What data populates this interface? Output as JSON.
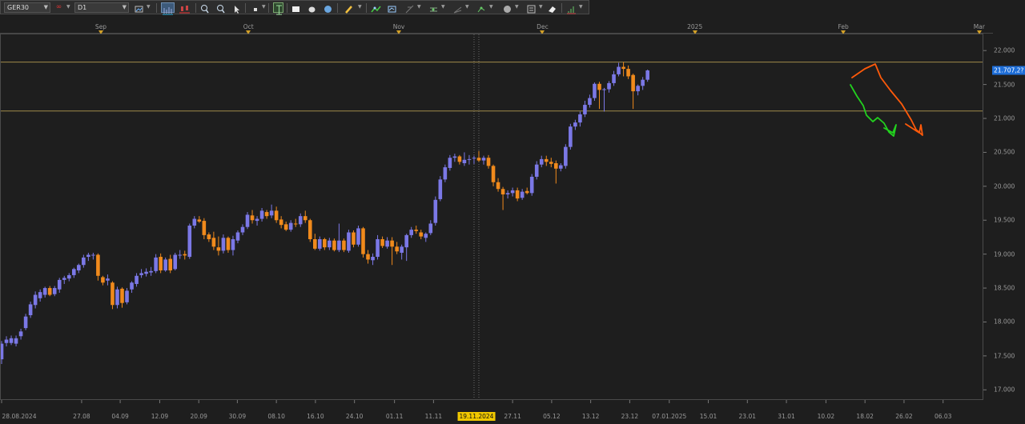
{
  "toolbar": {
    "symbol": "GER30",
    "timeframe": "D1",
    "link_glyph": "∞"
  },
  "top_axis": [
    {
      "label": "Sep",
      "day": 20.6
    },
    {
      "label": "Oct",
      "day": 51.2
    },
    {
      "label": "Nov",
      "day": 82.4
    },
    {
      "label": "Dec",
      "day": 112.2
    },
    {
      "label": "2025",
      "day": 143.8
    },
    {
      "label": "Feb",
      "day": 174.6
    },
    {
      "label": "Mar",
      "day": 202.8
    }
  ],
  "bottom_axis": [
    {
      "label": "28.08.2024",
      "day": 0
    },
    {
      "label": "27.08",
      "day": 16.6
    },
    {
      "label": "04.09",
      "day": 24.6
    },
    {
      "label": "12.09",
      "day": 32.8
    },
    {
      "label": "20.09",
      "day": 40.9
    },
    {
      "label": "30.09",
      "day": 48.9
    },
    {
      "label": "08.10",
      "day": 57.0
    },
    {
      "label": "16.10",
      "day": 65.1
    },
    {
      "label": "24.10",
      "day": 73.2
    },
    {
      "label": "01.11",
      "day": 81.5
    },
    {
      "label": "11.11",
      "day": 89.6
    },
    {
      "label": "27.11",
      "day": 106.0
    },
    {
      "label": "05.12",
      "day": 114.1
    },
    {
      "label": "13.12",
      "day": 122.2
    },
    {
      "label": "23.12",
      "day": 130.3
    },
    {
      "label": "07.01.2025",
      "day": 138.5
    },
    {
      "label": "15.01",
      "day": 146.6
    },
    {
      "label": "23.01",
      "day": 154.7
    },
    {
      "label": "31.01",
      "day": 162.8
    },
    {
      "label": "10.02",
      "day": 171.0
    },
    {
      "label": "18.02",
      "day": 179.1
    },
    {
      "label": "26.02",
      "day": 187.2
    },
    {
      "label": "06.03",
      "day": 195.3
    }
  ],
  "price_axis": [
    17000,
    17500,
    18000,
    18500,
    19000,
    19500,
    20000,
    20500,
    21000,
    21500,
    22000
  ],
  "price_axis_labels": [
    "17.000",
    "17.500",
    "18.000",
    "18.500",
    "19.000",
    "19.500",
    "20.000",
    "20.500",
    "21.000",
    "21.500",
    "22.000"
  ],
  "current_price": {
    "label": "21.707,2?",
    "value": 21707
  },
  "cursor": {
    "date_label": "19.11.2024",
    "day": 98.5
  },
  "hlines": [
    21830,
    21110
  ],
  "colors": {
    "bull": "#7b78e6",
    "bear": "#f08a1c",
    "hline": "#a08a4a",
    "arrow_orange": "#ff5a0a",
    "arrow_green": "#22d11e",
    "cursor_label": "#f0c800",
    "price_label": "#1e6ed8"
  },
  "chart_data": {
    "type": "candlestick",
    "ylim": [
      16850,
      22250
    ],
    "xlim_days": [
      0,
      200.5
    ],
    "candles": [
      {
        "day": 0,
        "o": 17450,
        "h": 17720,
        "l": 17380,
        "c": 17680
      },
      {
        "day": 1,
        "o": 17690,
        "h": 17790,
        "l": 17640,
        "c": 17740
      },
      {
        "day": 2,
        "o": 17690,
        "h": 17800,
        "l": 17660,
        "c": 17760
      },
      {
        "day": 3,
        "o": 17680,
        "h": 17800,
        "l": 17640,
        "c": 17760
      },
      {
        "day": 4,
        "o": 17790,
        "h": 17900,
        "l": 17740,
        "c": 17860
      },
      {
        "day": 5,
        "o": 17910,
        "h": 18120,
        "l": 17880,
        "c": 18080
      },
      {
        "day": 6,
        "o": 18100,
        "h": 18300,
        "l": 18060,
        "c": 18260
      },
      {
        "day": 7,
        "o": 18250,
        "h": 18450,
        "l": 18200,
        "c": 18400
      },
      {
        "day": 8,
        "o": 18350,
        "h": 18480,
        "l": 18300,
        "c": 18440
      },
      {
        "day": 9,
        "o": 18400,
        "h": 18520,
        "l": 18360,
        "c": 18500
      },
      {
        "day": 10,
        "o": 18500,
        "h": 18530,
        "l": 18380,
        "c": 18400
      },
      {
        "day": 11,
        "o": 18410,
        "h": 18530,
        "l": 18380,
        "c": 18500
      },
      {
        "day": 12,
        "o": 18480,
        "h": 18650,
        "l": 18430,
        "c": 18620
      },
      {
        "day": 13,
        "o": 18620,
        "h": 18680,
        "l": 18560,
        "c": 18650
      },
      {
        "day": 14,
        "o": 18640,
        "h": 18720,
        "l": 18600,
        "c": 18690
      },
      {
        "day": 15,
        "o": 18690,
        "h": 18800,
        "l": 18650,
        "c": 18780
      },
      {
        "day": 16,
        "o": 18760,
        "h": 18860,
        "l": 18720,
        "c": 18840
      },
      {
        "day": 17,
        "o": 18840,
        "h": 18990,
        "l": 18800,
        "c": 18950
      },
      {
        "day": 18,
        "o": 18960,
        "h": 19020,
        "l": 18900,
        "c": 18990
      },
      {
        "day": 19,
        "o": 18980,
        "h": 19020,
        "l": 18920,
        "c": 18990
      },
      {
        "day": 20,
        "o": 18990,
        "h": 19010,
        "l": 18610,
        "c": 18680
      },
      {
        "day": 21,
        "o": 18660,
        "h": 18680,
        "l": 18540,
        "c": 18580
      },
      {
        "day": 22,
        "o": 18610,
        "h": 18700,
        "l": 18540,
        "c": 18640
      },
      {
        "day": 23,
        "o": 18580,
        "h": 18600,
        "l": 18190,
        "c": 18250
      },
      {
        "day": 24,
        "o": 18250,
        "h": 18520,
        "l": 18200,
        "c": 18480
      },
      {
        "day": 25,
        "o": 18490,
        "h": 18510,
        "l": 18210,
        "c": 18280
      },
      {
        "day": 26,
        "o": 18290,
        "h": 18500,
        "l": 18260,
        "c": 18460
      },
      {
        "day": 27,
        "o": 18480,
        "h": 18600,
        "l": 18430,
        "c": 18580
      },
      {
        "day": 28,
        "o": 18560,
        "h": 18720,
        "l": 18520,
        "c": 18680
      },
      {
        "day": 29,
        "o": 18690,
        "h": 18780,
        "l": 18650,
        "c": 18720
      },
      {
        "day": 30,
        "o": 18710,
        "h": 18790,
        "l": 18670,
        "c": 18740
      },
      {
        "day": 31,
        "o": 18730,
        "h": 18810,
        "l": 18680,
        "c": 18750
      },
      {
        "day": 32,
        "o": 18750,
        "h": 19000,
        "l": 18720,
        "c": 18950
      },
      {
        "day": 33,
        "o": 18960,
        "h": 19010,
        "l": 18720,
        "c": 18760
      },
      {
        "day": 34,
        "o": 18760,
        "h": 18950,
        "l": 18740,
        "c": 18920
      },
      {
        "day": 35,
        "o": 18930,
        "h": 18990,
        "l": 18720,
        "c": 18760
      },
      {
        "day": 36,
        "o": 18780,
        "h": 19020,
        "l": 18760,
        "c": 18990
      },
      {
        "day": 37,
        "o": 18980,
        "h": 19060,
        "l": 18930,
        "c": 18990
      },
      {
        "day": 38,
        "o": 19000,
        "h": 19050,
        "l": 18920,
        "c": 18980
      },
      {
        "day": 39,
        "o": 18960,
        "h": 19450,
        "l": 18930,
        "c": 19420
      },
      {
        "day": 40,
        "o": 19420,
        "h": 19560,
        "l": 19380,
        "c": 19520
      },
      {
        "day": 41,
        "o": 19510,
        "h": 19560,
        "l": 19460,
        "c": 19480
      },
      {
        "day": 42,
        "o": 19490,
        "h": 19530,
        "l": 19220,
        "c": 19280
      },
      {
        "day": 43,
        "o": 19290,
        "h": 19320,
        "l": 19180,
        "c": 19220
      },
      {
        "day": 44,
        "o": 19240,
        "h": 19330,
        "l": 19060,
        "c": 19110
      },
      {
        "day": 45,
        "o": 19100,
        "h": 19260,
        "l": 18980,
        "c": 19050
      },
      {
        "day": 46,
        "o": 19050,
        "h": 19290,
        "l": 19010,
        "c": 19240
      },
      {
        "day": 47,
        "o": 19240,
        "h": 19260,
        "l": 19020,
        "c": 19060
      },
      {
        "day": 48,
        "o": 19060,
        "h": 19270,
        "l": 18980,
        "c": 19220
      },
      {
        "day": 49,
        "o": 19200,
        "h": 19350,
        "l": 19160,
        "c": 19320
      },
      {
        "day": 50,
        "o": 19320,
        "h": 19440,
        "l": 19280,
        "c": 19400
      },
      {
        "day": 51,
        "o": 19400,
        "h": 19620,
        "l": 19370,
        "c": 19580
      },
      {
        "day": 52,
        "o": 19570,
        "h": 19650,
        "l": 19450,
        "c": 19500
      },
      {
        "day": 53,
        "o": 19490,
        "h": 19560,
        "l": 19420,
        "c": 19520
      },
      {
        "day": 54,
        "o": 19520,
        "h": 19680,
        "l": 19480,
        "c": 19640
      },
      {
        "day": 55,
        "o": 19620,
        "h": 19650,
        "l": 19520,
        "c": 19560
      },
      {
        "day": 56,
        "o": 19570,
        "h": 19730,
        "l": 19530,
        "c": 19640
      },
      {
        "day": 57,
        "o": 19640,
        "h": 19700,
        "l": 19460,
        "c": 19500
      },
      {
        "day": 58,
        "o": 19510,
        "h": 19560,
        "l": 19380,
        "c": 19430
      },
      {
        "day": 59,
        "o": 19440,
        "h": 19480,
        "l": 19340,
        "c": 19360
      },
      {
        "day": 60,
        "o": 19360,
        "h": 19500,
        "l": 19330,
        "c": 19460
      },
      {
        "day": 61,
        "o": 19450,
        "h": 19520,
        "l": 19400,
        "c": 19440
      },
      {
        "day": 62,
        "o": 19440,
        "h": 19600,
        "l": 19400,
        "c": 19560
      },
      {
        "day": 63,
        "o": 19560,
        "h": 19640,
        "l": 19460,
        "c": 19500
      },
      {
        "day": 64,
        "o": 19500,
        "h": 19520,
        "l": 19180,
        "c": 19220
      },
      {
        "day": 65,
        "o": 19220,
        "h": 19300,
        "l": 19060,
        "c": 19080
      },
      {
        "day": 66,
        "o": 19080,
        "h": 19260,
        "l": 19050,
        "c": 19220
      },
      {
        "day": 67,
        "o": 19220,
        "h": 19240,
        "l": 19060,
        "c": 19100
      },
      {
        "day": 68,
        "o": 19100,
        "h": 19240,
        "l": 19060,
        "c": 19200
      },
      {
        "day": 69,
        "o": 19200,
        "h": 19230,
        "l": 19040,
        "c": 19060
      },
      {
        "day": 70,
        "o": 19060,
        "h": 19450,
        "l": 19030,
        "c": 19200
      },
      {
        "day": 71,
        "o": 19200,
        "h": 19230,
        "l": 19030,
        "c": 19060
      },
      {
        "day": 72,
        "o": 19050,
        "h": 19360,
        "l": 19020,
        "c": 19320
      },
      {
        "day": 73,
        "o": 19320,
        "h": 19350,
        "l": 19100,
        "c": 19140
      },
      {
        "day": 74,
        "o": 19140,
        "h": 19420,
        "l": 19110,
        "c": 19380
      },
      {
        "day": 75,
        "o": 19380,
        "h": 19400,
        "l": 18950,
        "c": 19000
      },
      {
        "day": 76,
        "o": 19000,
        "h": 19060,
        "l": 18860,
        "c": 18920
      },
      {
        "day": 77,
        "o": 18910,
        "h": 19010,
        "l": 18840,
        "c": 18960
      },
      {
        "day": 78,
        "o": 18960,
        "h": 19280,
        "l": 18920,
        "c": 19220
      },
      {
        "day": 79,
        "o": 19220,
        "h": 19260,
        "l": 19090,
        "c": 19120
      },
      {
        "day": 80,
        "o": 19110,
        "h": 19250,
        "l": 19080,
        "c": 19200
      },
      {
        "day": 81,
        "o": 19200,
        "h": 19250,
        "l": 18840,
        "c": 19110
      },
      {
        "day": 82,
        "o": 19110,
        "h": 19180,
        "l": 19000,
        "c": 19040
      },
      {
        "day": 83,
        "o": 19020,
        "h": 19140,
        "l": 18920,
        "c": 19110
      },
      {
        "day": 84,
        "o": 19100,
        "h": 19300,
        "l": 18900,
        "c": 19280
      },
      {
        "day": 85,
        "o": 19280,
        "h": 19400,
        "l": 19240,
        "c": 19360
      },
      {
        "day": 86,
        "o": 19360,
        "h": 19420,
        "l": 19300,
        "c": 19340
      },
      {
        "day": 87,
        "o": 19320,
        "h": 19360,
        "l": 19220,
        "c": 19260
      },
      {
        "day": 88,
        "o": 19240,
        "h": 19320,
        "l": 19180,
        "c": 19300
      },
      {
        "day": 89,
        "o": 19310,
        "h": 19500,
        "l": 19280,
        "c": 19450
      },
      {
        "day": 90,
        "o": 19460,
        "h": 19850,
        "l": 19420,
        "c": 19800
      },
      {
        "day": 91,
        "o": 19810,
        "h": 20150,
        "l": 19780,
        "c": 20100
      },
      {
        "day": 92,
        "o": 20100,
        "h": 20320,
        "l": 20060,
        "c": 20280
      },
      {
        "day": 93,
        "o": 20270,
        "h": 20460,
        "l": 20230,
        "c": 20420
      },
      {
        "day": 94,
        "o": 20420,
        "h": 20480,
        "l": 20360,
        "c": 20440
      },
      {
        "day": 95,
        "o": 20440,
        "h": 20460,
        "l": 20320,
        "c": 20360
      },
      {
        "day": 96,
        "o": 20340,
        "h": 20500,
        "l": 20300,
        "c": 20390
      },
      {
        "day": 97,
        "o": 20400,
        "h": 20460,
        "l": 20320,
        "c": 20400
      },
      {
        "day": 98,
        "o": 20410,
        "h": 20450,
        "l": 20330,
        "c": 20420
      },
      {
        "day": 99,
        "o": 20420,
        "h": 20520,
        "l": 20360,
        "c": 20380
      },
      {
        "day": 100,
        "o": 20380,
        "h": 20450,
        "l": 20320,
        "c": 20420
      },
      {
        "day": 101,
        "o": 20420,
        "h": 20460,
        "l": 20260,
        "c": 20300
      },
      {
        "day": 102,
        "o": 20300,
        "h": 20320,
        "l": 20000,
        "c": 20060
      },
      {
        "day": 103,
        "o": 20060,
        "h": 20120,
        "l": 19920,
        "c": 19960
      },
      {
        "day": 104,
        "o": 19960,
        "h": 19990,
        "l": 19650,
        "c": 19880
      },
      {
        "day": 105,
        "o": 19880,
        "h": 19940,
        "l": 19820,
        "c": 19900
      },
      {
        "day": 106,
        "o": 19900,
        "h": 19980,
        "l": 19850,
        "c": 19940
      },
      {
        "day": 107,
        "o": 19940,
        "h": 19980,
        "l": 19780,
        "c": 19820
      },
      {
        "day": 108,
        "o": 19830,
        "h": 19960,
        "l": 19800,
        "c": 19920
      },
      {
        "day": 109,
        "o": 19930,
        "h": 19980,
        "l": 19880,
        "c": 19900
      },
      {
        "day": 110,
        "o": 19900,
        "h": 20180,
        "l": 19860,
        "c": 20140
      },
      {
        "day": 111,
        "o": 20140,
        "h": 20370,
        "l": 20100,
        "c": 20320
      },
      {
        "day": 112,
        "o": 20320,
        "h": 20450,
        "l": 20280,
        "c": 20400
      },
      {
        "day": 113,
        "o": 20400,
        "h": 20450,
        "l": 20300,
        "c": 20360
      },
      {
        "day": 114,
        "o": 20360,
        "h": 20420,
        "l": 20280,
        "c": 20330
      },
      {
        "day": 115,
        "o": 20340,
        "h": 20380,
        "l": 20040,
        "c": 20260
      },
      {
        "day": 116,
        "o": 20260,
        "h": 20340,
        "l": 20220,
        "c": 20310
      },
      {
        "day": 117,
        "o": 20300,
        "h": 20620,
        "l": 20260,
        "c": 20580
      },
      {
        "day": 118,
        "o": 20580,
        "h": 20920,
        "l": 20540,
        "c": 20880
      },
      {
        "day": 119,
        "o": 20880,
        "h": 20980,
        "l": 20830,
        "c": 20940
      },
      {
        "day": 120,
        "o": 20940,
        "h": 21100,
        "l": 20880,
        "c": 21060
      },
      {
        "day": 121,
        "o": 21060,
        "h": 21260,
        "l": 21020,
        "c": 21200
      },
      {
        "day": 122,
        "o": 21200,
        "h": 21350,
        "l": 21160,
        "c": 21300
      },
      {
        "day": 123,
        "o": 21300,
        "h": 21530,
        "l": 21260,
        "c": 21510
      },
      {
        "day": 124,
        "o": 21510,
        "h": 21540,
        "l": 21140,
        "c": 21420
      },
      {
        "day": 125,
        "o": 21420,
        "h": 21450,
        "l": 21100,
        "c": 21430
      },
      {
        "day": 126,
        "o": 21430,
        "h": 21550,
        "l": 21380,
        "c": 21520
      },
      {
        "day": 127,
        "o": 21520,
        "h": 21700,
        "l": 21480,
        "c": 21650
      },
      {
        "day": 128,
        "o": 21650,
        "h": 21820,
        "l": 21620,
        "c": 21760
      },
      {
        "day": 129,
        "o": 21760,
        "h": 21830,
        "l": 21620,
        "c": 21730
      },
      {
        "day": 130,
        "o": 21730,
        "h": 21780,
        "l": 21580,
        "c": 21620
      },
      {
        "day": 131,
        "o": 21640,
        "h": 21660,
        "l": 21140,
        "c": 21400
      },
      {
        "day": 132,
        "o": 21400,
        "h": 21500,
        "l": 21340,
        "c": 21480
      },
      {
        "day": 133,
        "o": 21480,
        "h": 21610,
        "l": 21420,
        "c": 21570
      },
      {
        "day": 134,
        "o": 21570,
        "h": 21720,
        "l": 21540,
        "c": 21707
      }
    ]
  }
}
